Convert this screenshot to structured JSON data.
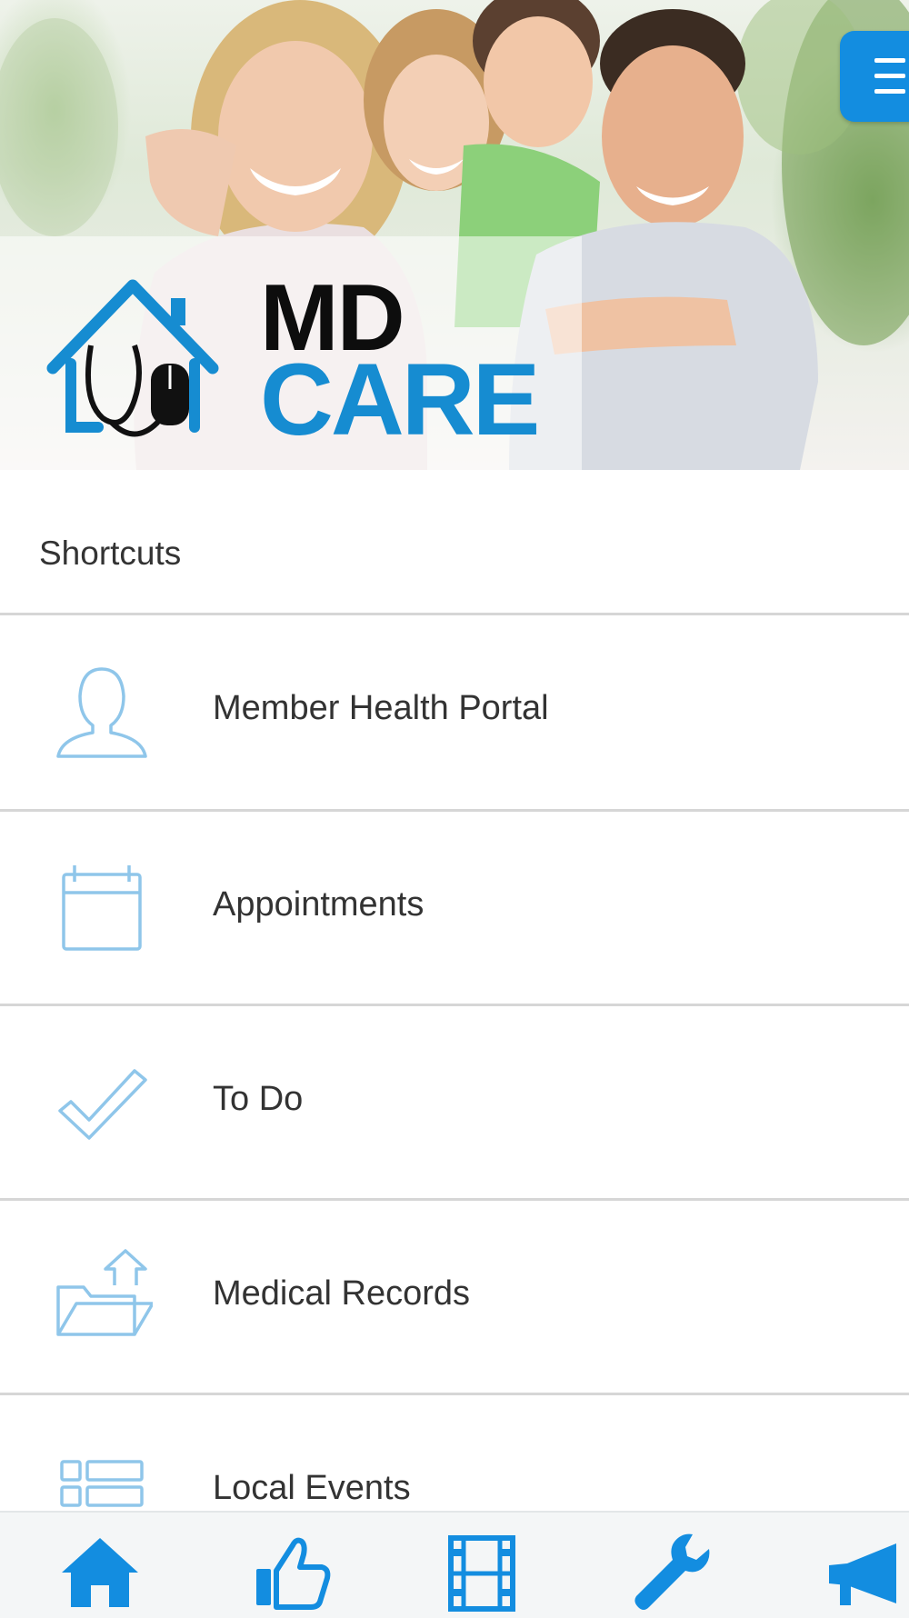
{
  "header": {
    "brand_line1": "MD",
    "brand_line2": "CARE",
    "logo_icons": [
      "house-icon",
      "stethoscope-icon",
      "mouse-icon"
    ],
    "menu_icon": "hamburger-menu-icon"
  },
  "shortcuts": {
    "title": "Shortcuts",
    "items": [
      {
        "label": "Member Health Portal",
        "icon": "user-icon"
      },
      {
        "label": "Appointments",
        "icon": "calendar-icon"
      },
      {
        "label": "To Do",
        "icon": "checkmark-icon"
      },
      {
        "label": "Medical Records",
        "icon": "folder-upload-icon"
      },
      {
        "label": "Local Events",
        "icon": "list-icon"
      }
    ]
  },
  "tabbar": {
    "tabs": [
      {
        "icon": "home-icon"
      },
      {
        "icon": "thumbs-up-icon"
      },
      {
        "icon": "film-icon"
      },
      {
        "icon": "wrench-icon"
      },
      {
        "icon": "megaphone-icon"
      }
    ]
  },
  "colors": {
    "accent": "#138de0",
    "logo_blue": "#168cd1",
    "icon_light_blue": "#8fc6ea",
    "divider": "#d6d6d6",
    "text": "#333333",
    "tabbar_bg": "#f4f6f7"
  }
}
